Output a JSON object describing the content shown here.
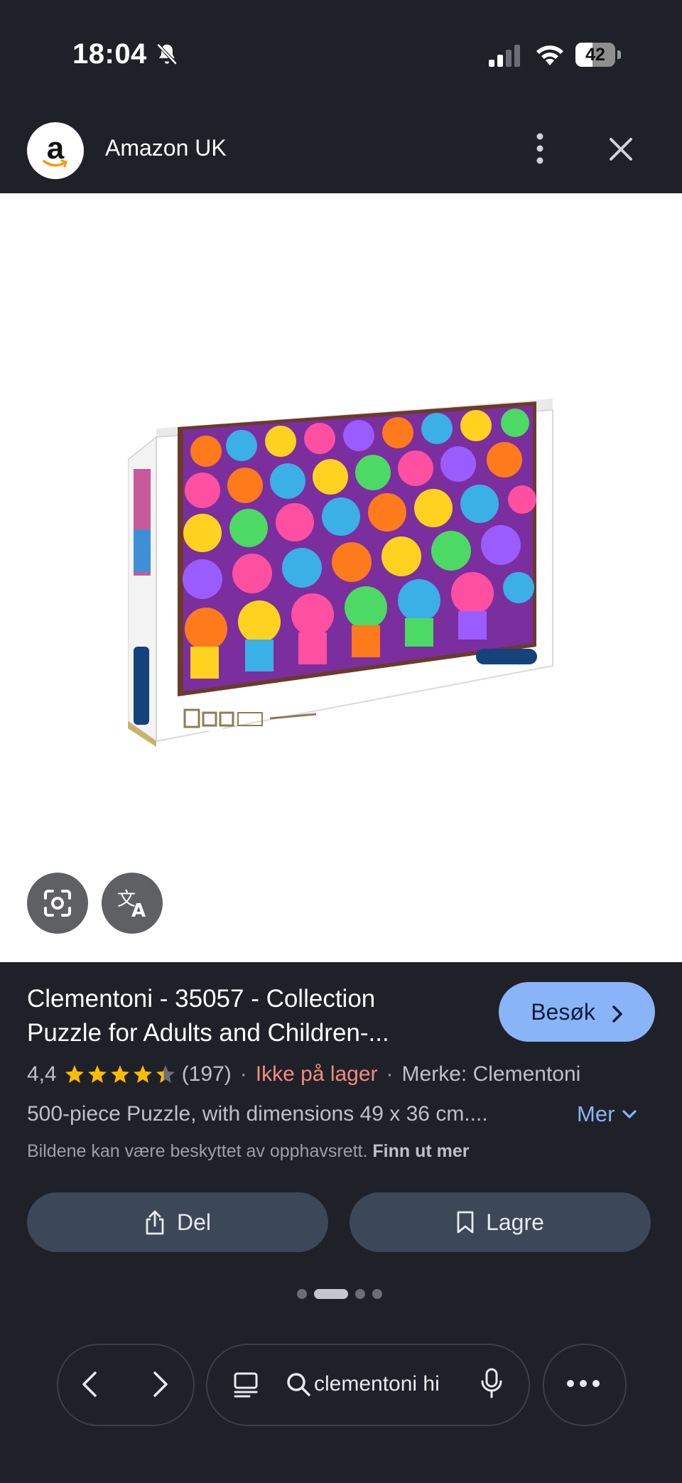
{
  "status_bar": {
    "time": "18:04",
    "battery": "42",
    "battery_level": 0.42,
    "icons": [
      "bell-off-icon",
      "cellular-signal-icon",
      "wifi-icon",
      "battery-icon"
    ]
  },
  "header": {
    "site_name": "Amazon UK",
    "logo_letter": "a",
    "icons": [
      "amazon-logo",
      "more-vert-icon",
      "close-icon"
    ]
  },
  "image_tools": {
    "icons": [
      "google-lens-icon",
      "translate-icon"
    ]
  },
  "product": {
    "title_line1": "Clementoni - 35057 - Collection",
    "title_line2": "Puzzle for Adults and Children-...",
    "visit_label": "Besøk",
    "rating": "4,4",
    "rating_value": 4.4,
    "reviews": "(197)",
    "separator": "·",
    "stock": "Ikke på lager",
    "brand": "Merke: Clementoni",
    "description": "500-piece Puzzle, with dimensions 49 x 36 cm....",
    "more_label": "Mer",
    "copyright_text": "Bildene kan være beskyttet av opphavsrett.",
    "copyright_link": "Finn ut mer"
  },
  "actions": {
    "share_label": "Del",
    "save_label": "Lagre"
  },
  "pager": {
    "count": 4,
    "active_index": 1
  },
  "bottom_nav": {
    "search_query": "clementoni hi",
    "icons": [
      "back-arrow-icon",
      "forward-arrow-icon",
      "tabs-icon",
      "search-icon",
      "mic-icon",
      "more-horiz-icon"
    ]
  },
  "colors": {
    "background": "#1f2128",
    "accent": "#8ab4f8",
    "out_of_stock": "#f28b82",
    "star": "#fbbc04",
    "button": "#3c4758"
  }
}
